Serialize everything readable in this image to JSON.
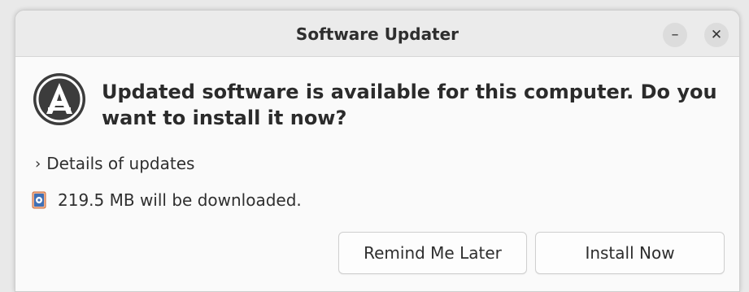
{
  "window": {
    "title": "Software Updater",
    "minimize_glyph": "–",
    "close_glyph": "✕"
  },
  "main": {
    "icon": "software-updater-icon",
    "headline": "Updated software is available for this computer. Do you want to install it now?",
    "details_label": "Details of updates",
    "details_chevron": "›",
    "download_icon": "package-icon",
    "download_text": "219.5 MB will be downloaded."
  },
  "buttons": {
    "remind_label": "Remind Me Later",
    "install_label": "Install Now"
  },
  "colors": {
    "accent_orange": "#e95420",
    "text": "#2e2e2e"
  }
}
